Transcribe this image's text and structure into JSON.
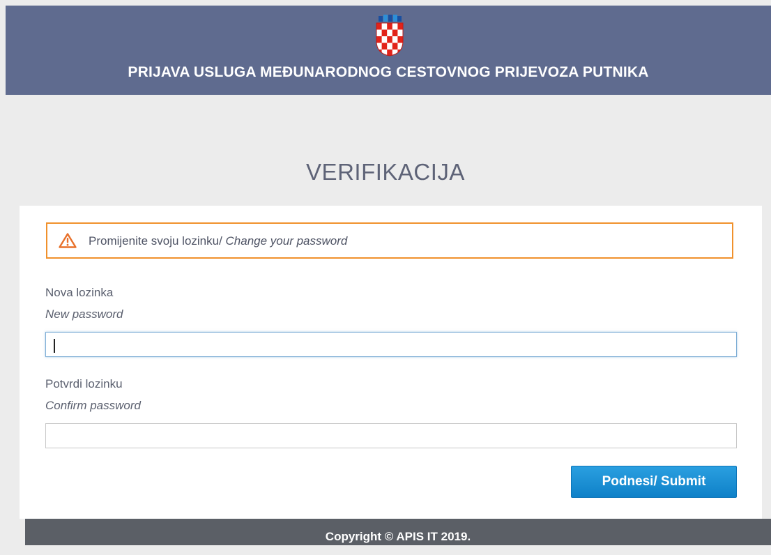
{
  "header": {
    "title": "PRIJAVA USLUGA MEĐUNARODNOG CESTOVNOG PRIJEVOZA PUTNIKA",
    "logo_icon": "croatian-coat-of-arms-icon"
  },
  "page": {
    "title": "VERIFIKACIJA"
  },
  "alert": {
    "icon": "warning-triangle-icon",
    "text_hr": "Promijenite svoju lozinku/ ",
    "text_en": "Change your password",
    "border_color": "#f0912c"
  },
  "form": {
    "new_password": {
      "label_hr": "Nova lozinka",
      "label_en": "New password",
      "value": ""
    },
    "confirm_password": {
      "label_hr": "Potvrdi lozinku",
      "label_en": "Confirm password",
      "value": ""
    },
    "submit_label": "Podnesi/ Submit"
  },
  "footer": {
    "text": "Copyright © APIS IT 2019."
  },
  "colors": {
    "header_bg": "#5f6b8f",
    "button_bg": "#1a8fd3",
    "footer_bg": "#5b5f66"
  }
}
